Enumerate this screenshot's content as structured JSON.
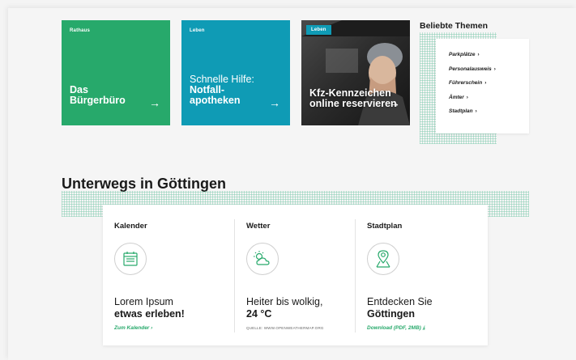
{
  "tiles": [
    {
      "category": "Rathaus",
      "title_thin": "",
      "title_bold": "Das Bürgerbüro",
      "arrow": "→",
      "color": "#27a96b"
    },
    {
      "category": "Leben",
      "title_thin": "Schnelle Hilfe:",
      "title_bold": "Notfall-apotheken",
      "arrow": "→",
      "color": "#0f9bb5"
    },
    {
      "category": "Leben",
      "title_thin": "",
      "title_bold": "Kfz-Kennzeichen online reservieren",
      "arrow": "→",
      "color": "#0f9bb5"
    }
  ],
  "beliebte_themen": {
    "title": "Beliebte Themen",
    "items": [
      "Parkplätze",
      "Personalausweis",
      "Führerschein",
      "Ämter",
      "Stadtplan"
    ],
    "chevron": "›"
  },
  "section": {
    "title": "Unterwegs in Göttingen",
    "cards": [
      {
        "heading": "Kalender",
        "icon": "calendar-icon",
        "line1": "Lorem Ipsum",
        "line2": "etwas erleben!",
        "link": "Zum Kalender ›"
      },
      {
        "heading": "Wetter",
        "icon": "cloud-sun-icon",
        "line1": "Heiter bis wolkig,",
        "line2": "24 °C",
        "source": "QUELLE: WWW.OPENWEATHERMAP.ORG"
      },
      {
        "heading": "Stadtplan",
        "icon": "map-pin-icon",
        "line1": "Entdecken Sie",
        "line2": "Göttingen",
        "link": "Download (PDF, 2MB) ⤓"
      }
    ]
  },
  "colors": {
    "green": "#27a96b",
    "teal": "#0f9bb5"
  }
}
